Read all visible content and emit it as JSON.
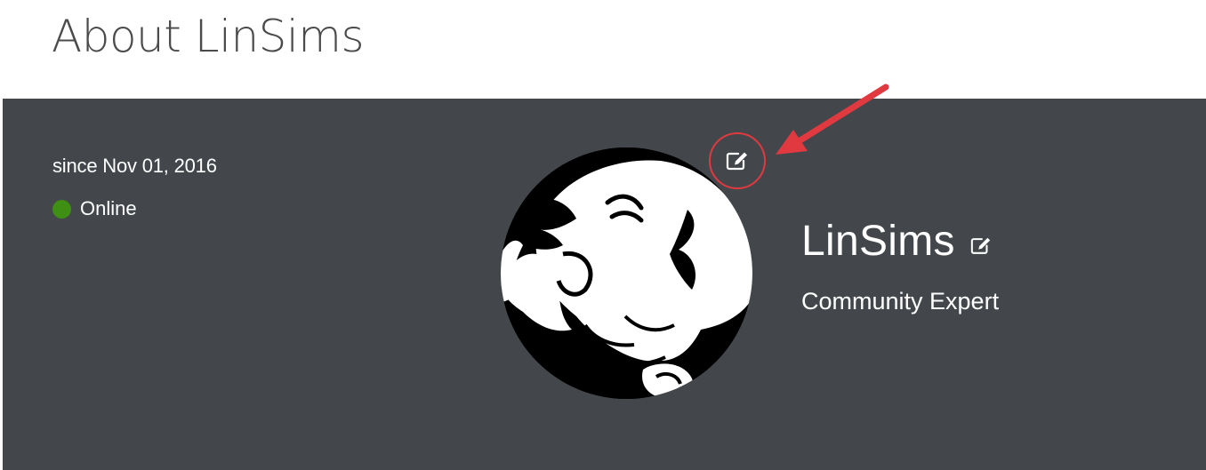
{
  "page": {
    "title": "About LinSims"
  },
  "profile": {
    "since": "since Nov 01, 2016",
    "status": "Online",
    "status_color": "#3e8f13",
    "username": "LinSims",
    "rank": "Community Expert",
    "avatar_icon": "cartoon-avatar-image",
    "avatar_edit_icon": "edit-icon",
    "name_edit_icon": "edit-icon"
  },
  "annotation": {
    "circle_color": "#e0393f",
    "arrow_color": "#e0393f"
  },
  "colors": {
    "panel_bg": "#43474b",
    "text": "#ffffff",
    "title": "#4b4b4b"
  }
}
